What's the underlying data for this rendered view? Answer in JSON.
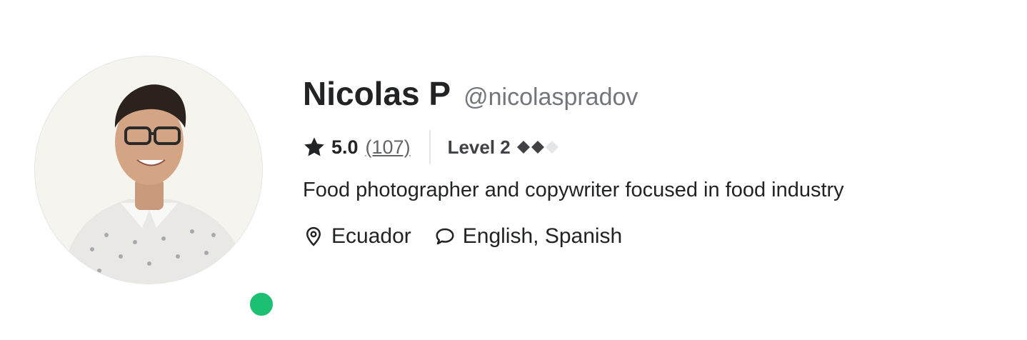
{
  "profile": {
    "name": "Nicolas P",
    "username": "@nicolaspradov",
    "online": true,
    "status_color": "#1dbf73"
  },
  "rating": {
    "icon": "star-icon",
    "value": "5.0",
    "count": "(107)"
  },
  "level": {
    "label": "Level 2",
    "diamonds_filled": 2,
    "diamonds_total": 3,
    "icon": "diamond-icon"
  },
  "tagline": "Food photographer and copywriter focused in food industry",
  "location": {
    "icon": "location-pin-icon",
    "label": "Ecuador"
  },
  "languages": {
    "icon": "chat-bubble-icon",
    "label": "English, Spanish"
  },
  "colors": {
    "text": "#222325",
    "muted": "#74767e",
    "online": "#1dbf73"
  }
}
